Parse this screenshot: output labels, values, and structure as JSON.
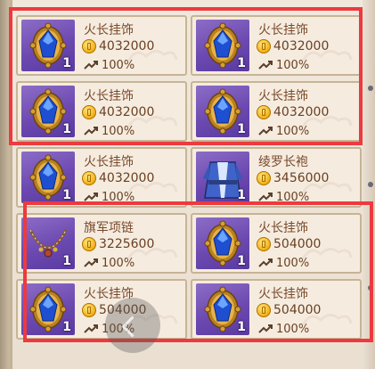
{
  "items": [
    {
      "name": "火长挂饰",
      "price": "4032000",
      "rate": "100%",
      "qty": "1",
      "icon": "amulet-icon"
    },
    {
      "name": "火长挂饰",
      "price": "4032000",
      "rate": "100%",
      "qty": "1",
      "icon": "amulet-icon"
    },
    {
      "name": "火长挂饰",
      "price": "4032000",
      "rate": "100%",
      "qty": "1",
      "icon": "amulet-icon"
    },
    {
      "name": "火长挂饰",
      "price": "4032000",
      "rate": "100%",
      "qty": "1",
      "icon": "amulet-icon"
    },
    {
      "name": "火长挂饰",
      "price": "4032000",
      "rate": "100%",
      "qty": "1",
      "icon": "amulet-icon"
    },
    {
      "name": "绫罗长袍",
      "price": "3456000",
      "rate": "100%",
      "qty": "1",
      "icon": "robe-icon"
    },
    {
      "name": "旗军项链",
      "price": "3225600",
      "rate": "100%",
      "qty": "1",
      "icon": "necklace-icon"
    },
    {
      "name": "火长挂饰",
      "price": "504000",
      "rate": "100%",
      "qty": "1",
      "icon": "amulet-icon"
    },
    {
      "name": "火长挂饰",
      "price": "504000",
      "rate": "100%",
      "qty": "1",
      "icon": "amulet-icon"
    },
    {
      "name": "火长挂饰",
      "price": "504000",
      "rate": "100%",
      "qty": "1",
      "icon": "amulet-icon"
    }
  ],
  "colors": {
    "highlight": "#ec3a3f",
    "card_bg": "#f5ecdf",
    "thumb_purple": "#7b58bb",
    "text_brown": "#6a3f22"
  },
  "icons": {
    "coin": "gold-coin-icon",
    "rate": "trend-up-icon",
    "float_button": "back-arrow-icon"
  }
}
